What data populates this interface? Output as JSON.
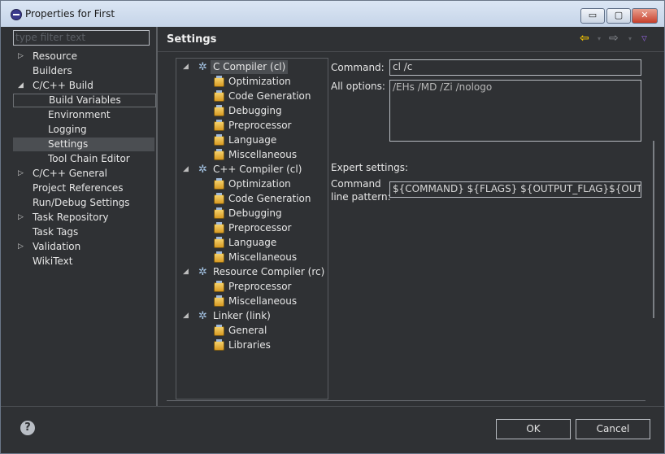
{
  "window": {
    "title": "Properties for First",
    "minimize_glyph": "▭",
    "maximize_glyph": "▢",
    "close_glyph": "✕"
  },
  "left": {
    "filter_placeholder": "type filter text",
    "items": [
      {
        "label": "Resource",
        "arrow": "▷",
        "level": 0
      },
      {
        "label": "Builders",
        "arrow": "",
        "level": 0
      },
      {
        "label": "C/C++ Build",
        "arrow": "◢",
        "level": 0
      },
      {
        "label": "Build Variables",
        "arrow": "",
        "level": 1,
        "framed": true
      },
      {
        "label": "Environment",
        "arrow": "",
        "level": 1
      },
      {
        "label": "Logging",
        "arrow": "",
        "level": 1
      },
      {
        "label": "Settings",
        "arrow": "",
        "level": 1,
        "selected": true
      },
      {
        "label": "Tool Chain Editor",
        "arrow": "",
        "level": 1
      },
      {
        "label": "C/C++ General",
        "arrow": "▷",
        "level": 0
      },
      {
        "label": "Project References",
        "arrow": "",
        "level": 0
      },
      {
        "label": "Run/Debug Settings",
        "arrow": "",
        "level": 0
      },
      {
        "label": "Task Repository",
        "arrow": "▷",
        "level": 0
      },
      {
        "label": "Task Tags",
        "arrow": "",
        "level": 0
      },
      {
        "label": "Validation",
        "arrow": "▷",
        "level": 0
      },
      {
        "label": "WikiText",
        "arrow": "",
        "level": 0
      }
    ]
  },
  "settings": {
    "heading": "Settings",
    "nav_glyphs": {
      "back": "⇦",
      "forward": "⇨",
      "menu": "▿"
    },
    "tree": [
      {
        "label": "C Compiler (cl)",
        "type": "tool",
        "selected": true
      },
      {
        "label": "Optimization",
        "type": "category"
      },
      {
        "label": "Code Generation",
        "type": "category"
      },
      {
        "label": "Debugging",
        "type": "category"
      },
      {
        "label": "Preprocessor",
        "type": "category"
      },
      {
        "label": "Language",
        "type": "category"
      },
      {
        "label": "Miscellaneous",
        "type": "category"
      },
      {
        "label": "C++ Compiler (cl)",
        "type": "tool"
      },
      {
        "label": "Optimization",
        "type": "category"
      },
      {
        "label": "Code Generation",
        "type": "category"
      },
      {
        "label": "Debugging",
        "type": "category"
      },
      {
        "label": "Preprocessor",
        "type": "category"
      },
      {
        "label": "Language",
        "type": "category"
      },
      {
        "label": "Miscellaneous",
        "type": "category"
      },
      {
        "label": "Resource Compiler (rc)",
        "type": "tool"
      },
      {
        "label": "Preprocessor",
        "type": "category"
      },
      {
        "label": "Miscellaneous",
        "type": "category"
      },
      {
        "label": "Linker (link)",
        "type": "tool"
      },
      {
        "label": "General",
        "type": "category"
      },
      {
        "label": "Libraries",
        "type": "category"
      }
    ],
    "command_label": "Command:",
    "command_value": "cl /c",
    "all_options_label": "All options:",
    "all_options_value": "/EHs /MD /Zi /nologo",
    "expert_label": "Expert settings:",
    "pattern_label_1": "Command",
    "pattern_label_2": "line pattern:",
    "pattern_value": "${COMMAND} ${FLAGS} ${OUTPUT_FLAG}${OUTPUT_PREFIX}${OUTPUT} ${INPUTS}"
  },
  "footer": {
    "help_glyph": "?",
    "ok_label": "OK",
    "cancel_label": "Cancel"
  },
  "colors": {
    "background": "#2f3134",
    "accent_arrow": "#f2c200"
  }
}
